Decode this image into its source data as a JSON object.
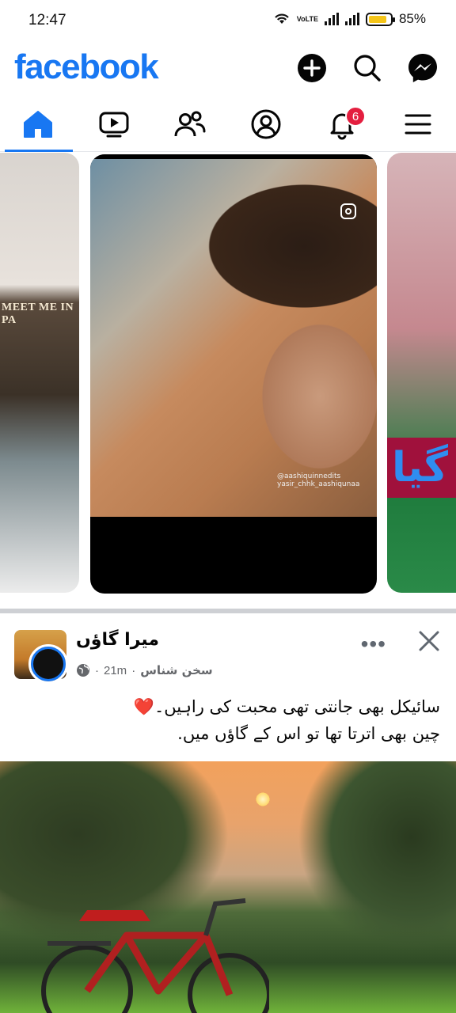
{
  "status_bar": {
    "time": "12:47",
    "network_label": "VoLTE",
    "battery_percent": "85%",
    "battery_level": 0.85
  },
  "header": {
    "logo_text": "facebook",
    "brand_color": "#1877f2",
    "actions": [
      "plus-icon",
      "search-icon",
      "messenger-icon"
    ]
  },
  "tabs": {
    "items": [
      "home-icon",
      "video-icon",
      "friends-icon",
      "profile-icon",
      "notifications-icon",
      "menu-icon"
    ],
    "active": "home",
    "notification_count": "6"
  },
  "reels": {
    "left_sign_text": "MEET ME IN PA",
    "main_watermark": "@aashiquinnedits",
    "main_sub_watermark": "yasir_chhk_aashiqunaa",
    "right_banner_text": "گیا"
  },
  "post": {
    "page_name": "میرا گاؤں",
    "author": "سخن شناس",
    "time": "21m",
    "text_lines": [
      "سائیکل بھی جانتی تھی محبت کی راہیں۔❤️",
      "چین بھی اترتا تھا تو اس کے گاؤں میں."
    ]
  }
}
